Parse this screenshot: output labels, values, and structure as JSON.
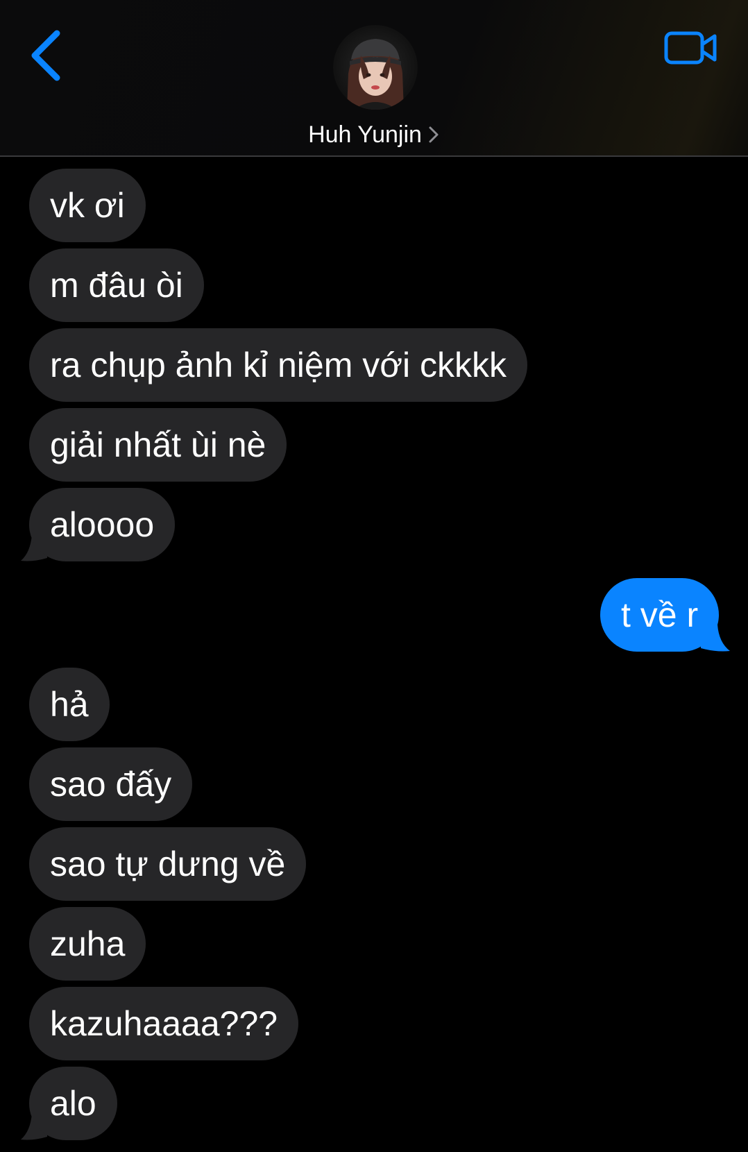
{
  "header": {
    "contact_name": "Huh Yunjin",
    "back_icon": "chevron-left-icon",
    "video_icon": "video-camera-icon",
    "accent_color": "#0a84ff"
  },
  "messages": [
    {
      "sender": "them",
      "text": "vk ơi"
    },
    {
      "sender": "them",
      "text": "m đâu òi"
    },
    {
      "sender": "them",
      "text": "ra chụp ảnh kỉ niệm với ckkkk"
    },
    {
      "sender": "them",
      "text": "giải nhất ùi nè"
    },
    {
      "sender": "them",
      "text": "aloooo"
    },
    {
      "sender": "me",
      "text": "t về r"
    },
    {
      "sender": "them",
      "text": "hả"
    },
    {
      "sender": "them",
      "text": "sao đấy"
    },
    {
      "sender": "them",
      "text": "sao tự dưng về"
    },
    {
      "sender": "them",
      "text": "zuha"
    },
    {
      "sender": "them",
      "text": "kazuhaaaa???"
    },
    {
      "sender": "them",
      "text": "alo"
    }
  ],
  "colors": {
    "incoming_bubble": "#262628",
    "outgoing_bubble": "#0a84ff",
    "background": "#000000"
  }
}
